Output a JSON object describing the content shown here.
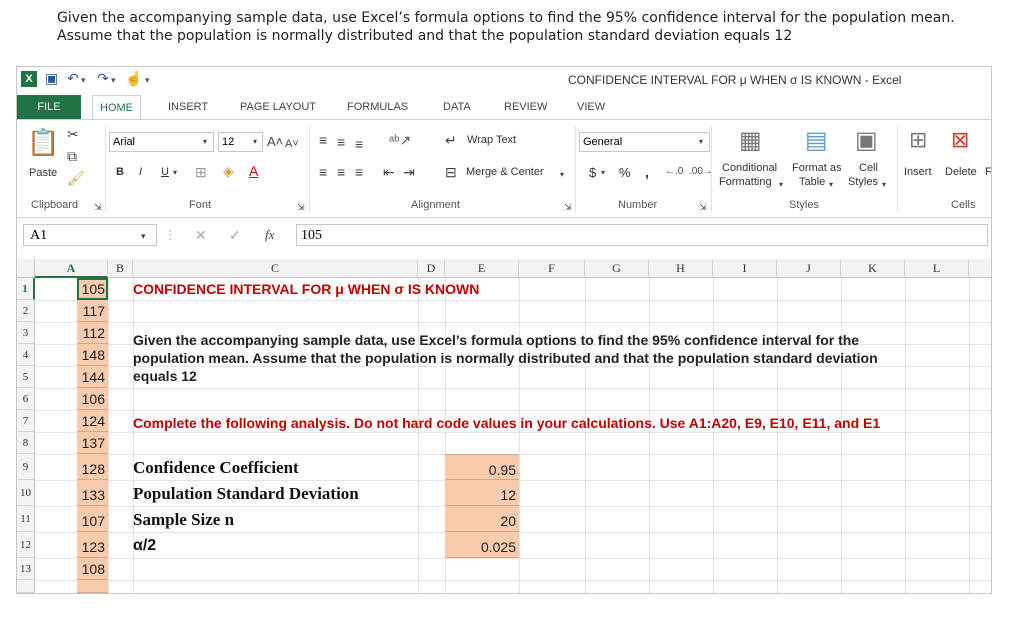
{
  "question": {
    "line1": "Given the accompanying sample data, use Excel’s formula options to find the 95% confidence interval for the population mean.",
    "line2": "Assume that the population is normally distributed and that the population standard deviation equals 12"
  },
  "window": {
    "title": "CONFIDENCE INTERVAL FOR μ WHEN σ IS KNOWN - Excel"
  },
  "tabs": [
    "FILE",
    "HOME",
    "INSERT",
    "PAGE LAYOUT",
    "FORMULAS",
    "DATA",
    "REVIEW",
    "VIEW"
  ],
  "ribbon": {
    "clipboard": {
      "paste": "Paste",
      "label": "Clipboard"
    },
    "font": {
      "name": "Arial",
      "size": "12",
      "bold": "B",
      "italic": "I",
      "underline": "U",
      "label": "Font"
    },
    "alignment": {
      "wrap": "Wrap Text",
      "merge": "Merge & Center",
      "label": "Alignment"
    },
    "number": {
      "format": "General",
      "currency": "$",
      "percent": "%",
      "comma": ",",
      "label": "Number"
    },
    "styles": {
      "conditional1": "Conditional",
      "conditional2": "Formatting",
      "table1": "Format as",
      "table2": "Table",
      "cell1": "Cell",
      "cell2": "Styles",
      "label": "Styles"
    },
    "cells": {
      "insert": "Insert",
      "delete": "Delete",
      "format": "F",
      "label": "Cells"
    }
  },
  "formula_bar": {
    "name_box": "A1",
    "fx": "fx",
    "value": "105"
  },
  "columns": [
    "A",
    "B",
    "C",
    "D",
    "E",
    "F",
    "G",
    "H",
    "I",
    "J",
    "K",
    "L"
  ],
  "rows": [
    "1",
    "2",
    "3",
    "4",
    "5",
    "6",
    "7",
    "8",
    "9",
    "10",
    "11",
    "12",
    "13"
  ],
  "col_a": [
    "105",
    "117",
    "112",
    "148",
    "144",
    "106",
    "124",
    "137",
    "128",
    "133",
    "107",
    "123",
    "108"
  ],
  "sheet": {
    "title": "CONFIDENCE INTERVAL FOR μ WHEN σ IS KNOWN",
    "q1": "Given the accompanying sample data, use Excel’s formula options to find the 95% confidence interval for the",
    "q2": "population mean. Assume that the population is normally distributed and that the population standard deviation",
    "q3": "equals 12",
    "instruction": "Complete the following analysis. Do not hard code values in your calculations.  Use A1:A20, E9, E10, E11, and E1",
    "labels": [
      "Confidence Coefficient",
      "Population Standard Deviation",
      "Sample Size n",
      "α/2"
    ],
    "values": [
      "0.95",
      "12",
      "20",
      "0.025"
    ]
  },
  "colors": {
    "excel_green": "#217346",
    "input_fill": "#f8cbad",
    "red_text": "#c00000"
  }
}
